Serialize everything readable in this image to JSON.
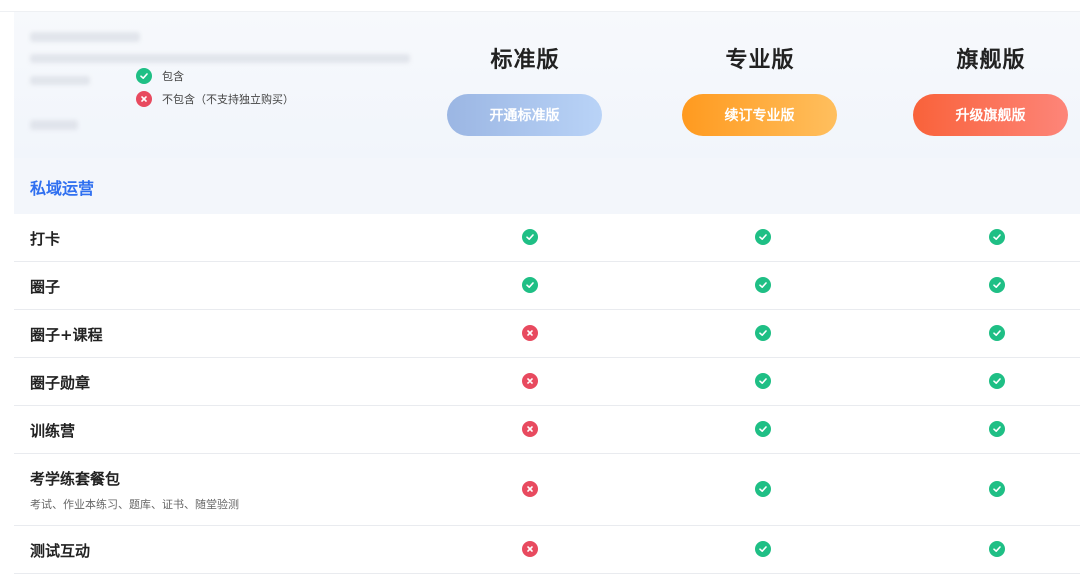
{
  "legend": {
    "included": "包含",
    "excluded": "不包含（不支持独立购买）"
  },
  "plans": [
    {
      "name": "标准版",
      "button": "开通标准版"
    },
    {
      "name": "专业版",
      "button": "续订专业版"
    },
    {
      "name": "旗舰版",
      "button": "升级旗舰版"
    }
  ],
  "section": {
    "title": "私域运营"
  },
  "features": [
    {
      "label": "打卡",
      "sub": "",
      "values": [
        "ok",
        "ok",
        "ok"
      ]
    },
    {
      "label": "圈子",
      "sub": "",
      "values": [
        "ok",
        "ok",
        "ok"
      ]
    },
    {
      "label": "圈子+课程",
      "sub": "",
      "values": [
        "no",
        "ok",
        "ok"
      ]
    },
    {
      "label": "圈子勋章",
      "sub": "",
      "values": [
        "no",
        "ok",
        "ok"
      ]
    },
    {
      "label": "训练营",
      "sub": "",
      "values": [
        "no",
        "ok",
        "ok"
      ]
    },
    {
      "label": "考学练套餐包",
      "sub": "考试、作业本练习、题库、证书、随堂验测",
      "values": [
        "no",
        "ok",
        "ok"
      ]
    },
    {
      "label": "测试互动",
      "sub": "",
      "values": [
        "no",
        "ok",
        "ok"
      ]
    }
  ],
  "colors": {
    "accent": "#2f6ff0",
    "included": "#1fbf85",
    "excluded": "#e84a5f"
  },
  "icons": {
    "included": "check-circle-icon",
    "excluded": "x-circle-icon"
  }
}
